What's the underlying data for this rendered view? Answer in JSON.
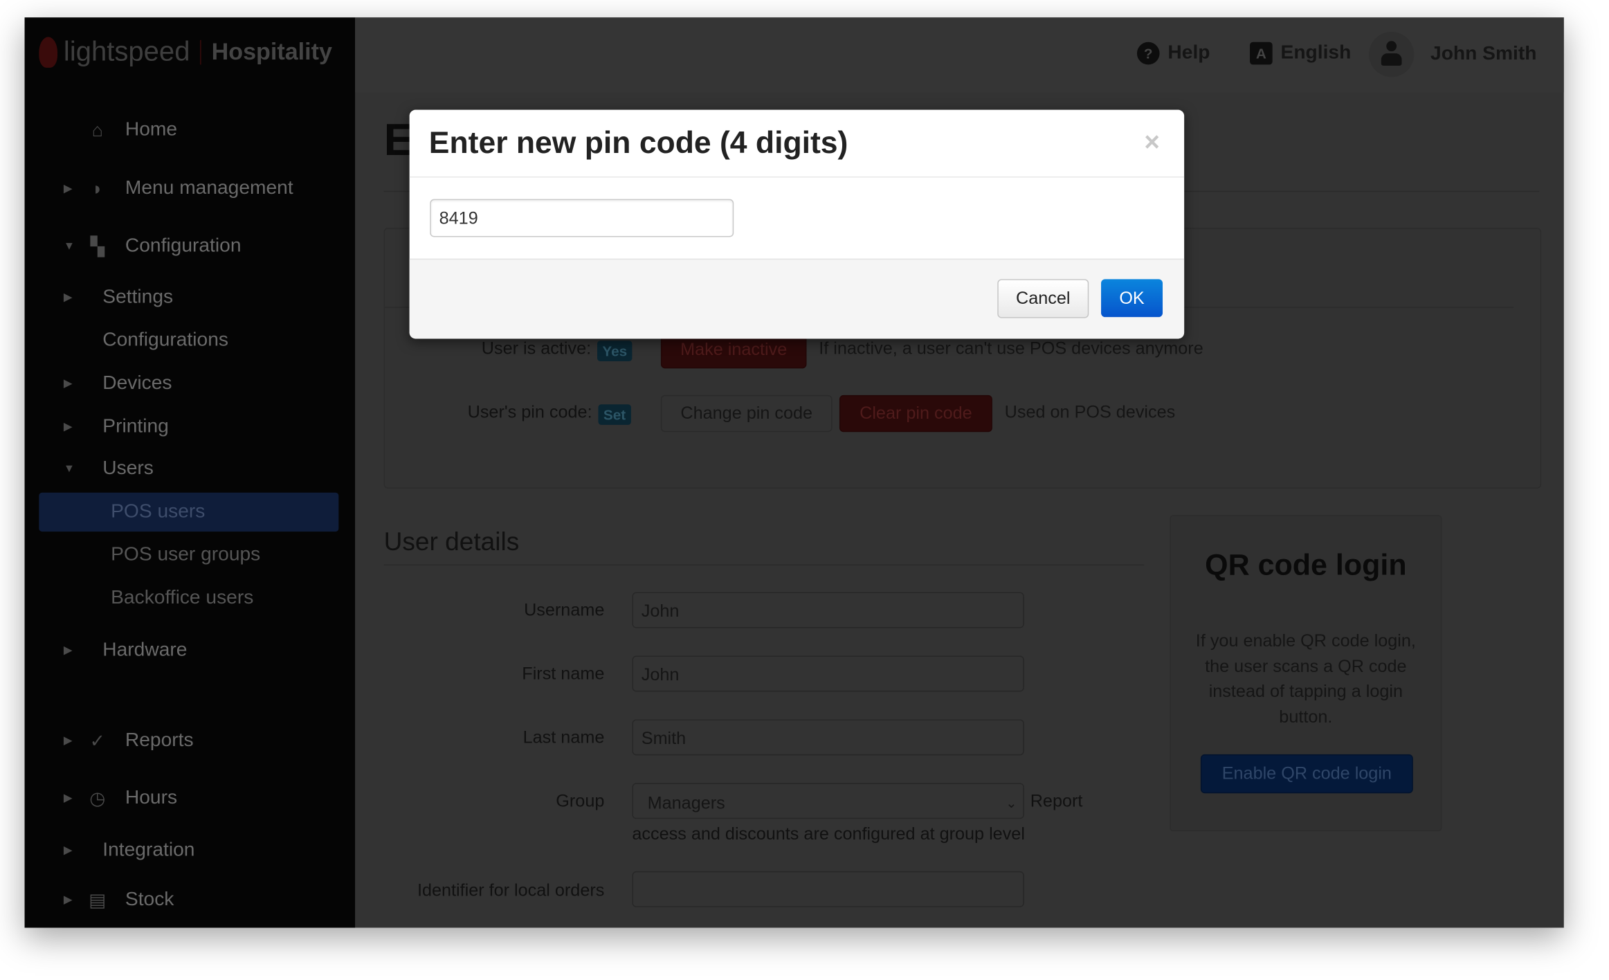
{
  "sidebar": {
    "brand": "lightspeed",
    "product": "Hospitality",
    "items": [
      {
        "label": "Home",
        "icon": "home-icon"
      },
      {
        "label": "Menu management",
        "icon": "menu-icon"
      },
      {
        "label": "Configuration",
        "icon": "configuration-icon"
      },
      {
        "label": "Settings"
      },
      {
        "label": "Configurations"
      },
      {
        "label": "Devices"
      },
      {
        "label": "Printing"
      },
      {
        "label": "Users"
      },
      {
        "label": "POS users",
        "active": true
      },
      {
        "label": "POS user groups"
      },
      {
        "label": "Backoffice users"
      },
      {
        "label": "Hardware"
      },
      {
        "label": "Reports",
        "icon": "chart-icon"
      },
      {
        "label": "Hours",
        "icon": "clock-icon"
      },
      {
        "label": "Integration"
      },
      {
        "label": "Stock",
        "icon": "box-icon"
      }
    ]
  },
  "header": {
    "help": "Help",
    "language": "English",
    "language_icon_letter": "A",
    "user": "John Smith"
  },
  "page": {
    "title_partial": "E",
    "active_label": "User is active:",
    "active_badge": "Yes",
    "make_inactive": "Make inactive",
    "inactive_help": "If inactive, a user can't use POS devices anymore",
    "pin_label": "User's pin code:",
    "pin_badge": "Set",
    "change_pin": "Change pin code",
    "clear_pin": "Clear pin code",
    "pin_help": "Used on POS devices"
  },
  "details": {
    "title": "User details",
    "username_label": "Username",
    "username": "John",
    "firstname_label": "First name",
    "firstname": "John",
    "lastname_label": "Last name",
    "lastname": "Smith",
    "group_label": "Group",
    "group": "Managers",
    "group_help_1": "Report",
    "group_help_2": "access and discounts are configured at group level",
    "identifier_label": "Identifier for local orders",
    "identifier": ""
  },
  "qr": {
    "title": "QR code login",
    "text": "If you enable QR code login, the user scans a QR code instead of tapping a login button.",
    "button": "Enable QR code login"
  },
  "modal": {
    "title": "Enter new pin code (4 digits)",
    "close": "×",
    "value": "8419",
    "cancel": "Cancel",
    "ok": "OK"
  },
  "colors": {
    "ok_button": "#0a6ad8",
    "sidebar_active": "#0f1d3a"
  }
}
